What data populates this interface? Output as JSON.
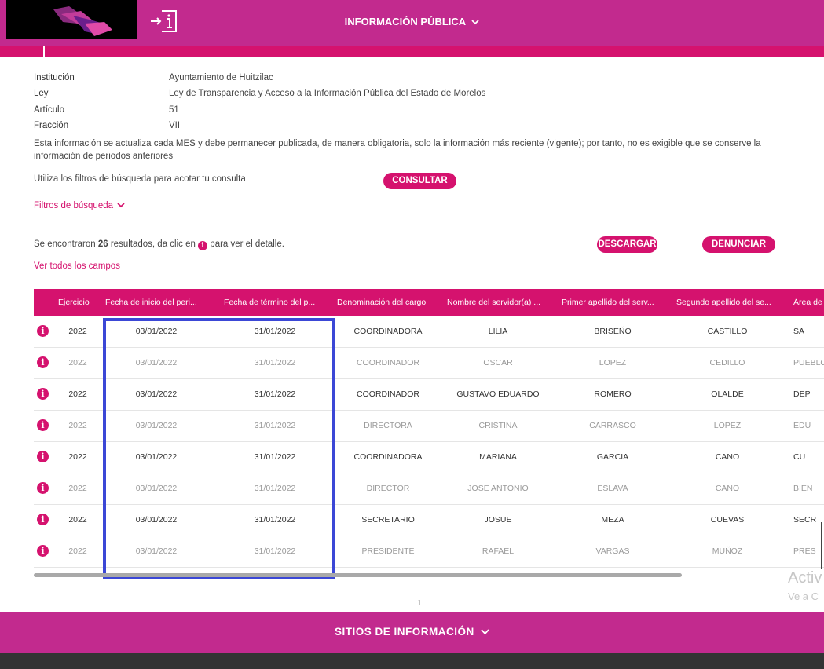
{
  "header": {
    "title": "INFORMACIÓN PÚBLICA"
  },
  "meta": {
    "institucion_label": "Institución",
    "institucion_value": "Ayuntamiento de Huitzilac",
    "ley_label": "Ley",
    "ley_value": "Ley de Transparencia y Acceso a la Información Pública del Estado de Morelos",
    "articulo_label": "Artículo",
    "articulo_value": "51",
    "fraccion_label": "Fracción",
    "fraccion_value": "VII",
    "note": "Esta información se actualiza cada MES y debe permanecer publicada, de manera obligatoria, solo la información más reciente (vigente); por tanto, no es exigible que se conserve la información de periodos anteriores"
  },
  "filters": {
    "hint": "Utiliza los filtros de búsqueda para acotar tu consulta",
    "consultar_label": "CONSULTAR",
    "toggle_label": "Filtros de búsqueda"
  },
  "results": {
    "prefix": "Se encontraron",
    "count": "26",
    "middle": "resultados, da clic en",
    "suffix": "para ver el detalle.",
    "descargar_label": "DESCARGAR",
    "denunciar_label": "DENUNCIAR",
    "ver_todos_label": "Ver todos los campos"
  },
  "table": {
    "headers": [
      "Ejercicio",
      "Fecha de inicio del peri...",
      "Fecha de término del p...",
      "Denominación del cargo",
      "Nombre del servidor(a) ...",
      "Primer apellido del serv...",
      "Segundo apellido del se...",
      "Área de"
    ],
    "rows": [
      [
        "2022",
        "03/01/2022",
        "31/01/2022",
        "COORDINADORA",
        "LILIA",
        "BRISEÑO",
        "CASTILLO",
        "SA"
      ],
      [
        "2022",
        "03/01/2022",
        "31/01/2022",
        "COORDINADOR",
        "OSCAR",
        "LOPEZ",
        "CEDILLO",
        "PUEBLO"
      ],
      [
        "2022",
        "03/01/2022",
        "31/01/2022",
        "COORDINADOR",
        "GUSTAVO EDUARDO",
        "ROMERO",
        "OLALDE",
        "DEP"
      ],
      [
        "2022",
        "03/01/2022",
        "31/01/2022",
        "DIRECTORA",
        "CRISTINA",
        "CARRASCO",
        "LOPEZ",
        "EDU"
      ],
      [
        "2022",
        "03/01/2022",
        "31/01/2022",
        "COORDINADORA",
        "MARIANA",
        "GARCIA",
        "CANO",
        "CU"
      ],
      [
        "2022",
        "03/01/2022",
        "31/01/2022",
        "DIRECTOR",
        "JOSE ANTONIO",
        "ESLAVA",
        "CANO",
        "BIEN"
      ],
      [
        "2022",
        "03/01/2022",
        "31/01/2022",
        "SECRETARIO",
        "JOSUE",
        "MEZA",
        "CUEVAS",
        "SECR"
      ],
      [
        "2022",
        "03/01/2022",
        "31/01/2022",
        "PRESIDENTE",
        "RAFAEL",
        "VARGAS",
        "MUÑOZ",
        "PRES"
      ]
    ]
  },
  "pagination": {
    "current": "1"
  },
  "watermark": {
    "line1": "Activ",
    "line2": "Ve a C"
  },
  "footer": {
    "title": "SITIOS DE INFORMACIÓN"
  },
  "colors": {
    "primary": "#c22a8e",
    "accent": "#d5126e",
    "highlight": "#3b47d6"
  }
}
